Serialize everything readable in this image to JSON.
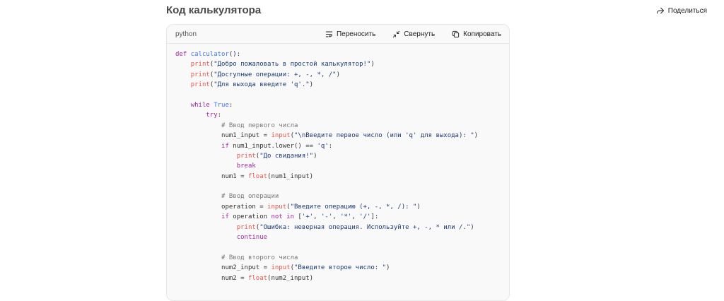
{
  "header": {
    "title": "Код калькулятора",
    "share_label": "Поделиться"
  },
  "code_block": {
    "language": "python",
    "wrap_label": "Переносить",
    "collapse_label": "Свернуть",
    "copy_label": "Копировать",
    "lines": [
      [
        {
          "t": "def ",
          "c": "kw"
        },
        {
          "t": "calculator",
          "c": "fn"
        },
        {
          "t": "():",
          "c": ""
        }
      ],
      [
        {
          "t": "    ",
          "c": ""
        },
        {
          "t": "print",
          "c": "bi"
        },
        {
          "t": "(",
          "c": ""
        },
        {
          "t": "\"Добро пожаловать в простой калькулятор!\"",
          "c": "str"
        },
        {
          "t": ")",
          "c": ""
        }
      ],
      [
        {
          "t": "    ",
          "c": ""
        },
        {
          "t": "print",
          "c": "bi"
        },
        {
          "t": "(",
          "c": ""
        },
        {
          "t": "\"Доступные операции: +, -, *, /\"",
          "c": "str"
        },
        {
          "t": ")",
          "c": ""
        }
      ],
      [
        {
          "t": "    ",
          "c": ""
        },
        {
          "t": "print",
          "c": "bi"
        },
        {
          "t": "(",
          "c": ""
        },
        {
          "t": "\"Для выхода введите 'q'.\"",
          "c": "str"
        },
        {
          "t": ")",
          "c": ""
        }
      ],
      [],
      [
        {
          "t": "    ",
          "c": ""
        },
        {
          "t": "while ",
          "c": "kw"
        },
        {
          "t": "True",
          "c": "fn"
        },
        {
          "t": ":",
          "c": ""
        }
      ],
      [
        {
          "t": "        ",
          "c": ""
        },
        {
          "t": "try",
          "c": "kw"
        },
        {
          "t": ":",
          "c": ""
        }
      ],
      [
        {
          "t": "            ",
          "c": ""
        },
        {
          "t": "# Ввод первого числа",
          "c": "cm"
        }
      ],
      [
        {
          "t": "            num1_input = ",
          "c": ""
        },
        {
          "t": "input",
          "c": "bi"
        },
        {
          "t": "(",
          "c": ""
        },
        {
          "t": "\"\\nВведите первое число (или 'q' для выхода): \"",
          "c": "str"
        },
        {
          "t": ")",
          "c": ""
        }
      ],
      [
        {
          "t": "            ",
          "c": ""
        },
        {
          "t": "if ",
          "c": "kw"
        },
        {
          "t": "num1_input.lower() == ",
          "c": ""
        },
        {
          "t": "'q'",
          "c": "str"
        },
        {
          "t": ":",
          "c": ""
        }
      ],
      [
        {
          "t": "                ",
          "c": ""
        },
        {
          "t": "print",
          "c": "bi"
        },
        {
          "t": "(",
          "c": ""
        },
        {
          "t": "\"До свидания!\"",
          "c": "str"
        },
        {
          "t": ")",
          "c": ""
        }
      ],
      [
        {
          "t": "                ",
          "c": ""
        },
        {
          "t": "break",
          "c": "kw"
        }
      ],
      [
        {
          "t": "            num1 = ",
          "c": ""
        },
        {
          "t": "float",
          "c": "bi"
        },
        {
          "t": "(num1_input)",
          "c": ""
        }
      ],
      [],
      [
        {
          "t": "            ",
          "c": ""
        },
        {
          "t": "# Ввод операции",
          "c": "cm"
        }
      ],
      [
        {
          "t": "            operation = ",
          "c": ""
        },
        {
          "t": "input",
          "c": "bi"
        },
        {
          "t": "(",
          "c": ""
        },
        {
          "t": "\"Введите операцию (+, -, *, /): \"",
          "c": "str"
        },
        {
          "t": ")",
          "c": ""
        }
      ],
      [
        {
          "t": "            ",
          "c": ""
        },
        {
          "t": "if ",
          "c": "kw"
        },
        {
          "t": "operation ",
          "c": ""
        },
        {
          "t": "not in ",
          "c": "kw"
        },
        {
          "t": "[",
          "c": ""
        },
        {
          "t": "'+'",
          "c": "str"
        },
        {
          "t": ", ",
          "c": ""
        },
        {
          "t": "'-'",
          "c": "str"
        },
        {
          "t": ", ",
          "c": ""
        },
        {
          "t": "'*'",
          "c": "str"
        },
        {
          "t": ", ",
          "c": ""
        },
        {
          "t": "'/'",
          "c": "str"
        },
        {
          "t": "]:",
          "c": ""
        }
      ],
      [
        {
          "t": "                ",
          "c": ""
        },
        {
          "t": "print",
          "c": "bi"
        },
        {
          "t": "(",
          "c": ""
        },
        {
          "t": "\"Ошибка: неверная операция. Используйте +, -, * или /.\"",
          "c": "str"
        },
        {
          "t": ")",
          "c": ""
        }
      ],
      [
        {
          "t": "                ",
          "c": ""
        },
        {
          "t": "continue",
          "c": "kw"
        }
      ],
      [],
      [
        {
          "t": "            ",
          "c": ""
        },
        {
          "t": "# Ввод второго числа",
          "c": "cm"
        }
      ],
      [
        {
          "t": "            num2_input = ",
          "c": ""
        },
        {
          "t": "input",
          "c": "bi"
        },
        {
          "t": "(",
          "c": ""
        },
        {
          "t": "\"Введите второе число: \"",
          "c": "str"
        },
        {
          "t": ")",
          "c": ""
        }
      ],
      [
        {
          "t": "            num2 = ",
          "c": ""
        },
        {
          "t": "float",
          "c": "bi"
        },
        {
          "t": "(num2_input)",
          "c": ""
        }
      ]
    ]
  }
}
